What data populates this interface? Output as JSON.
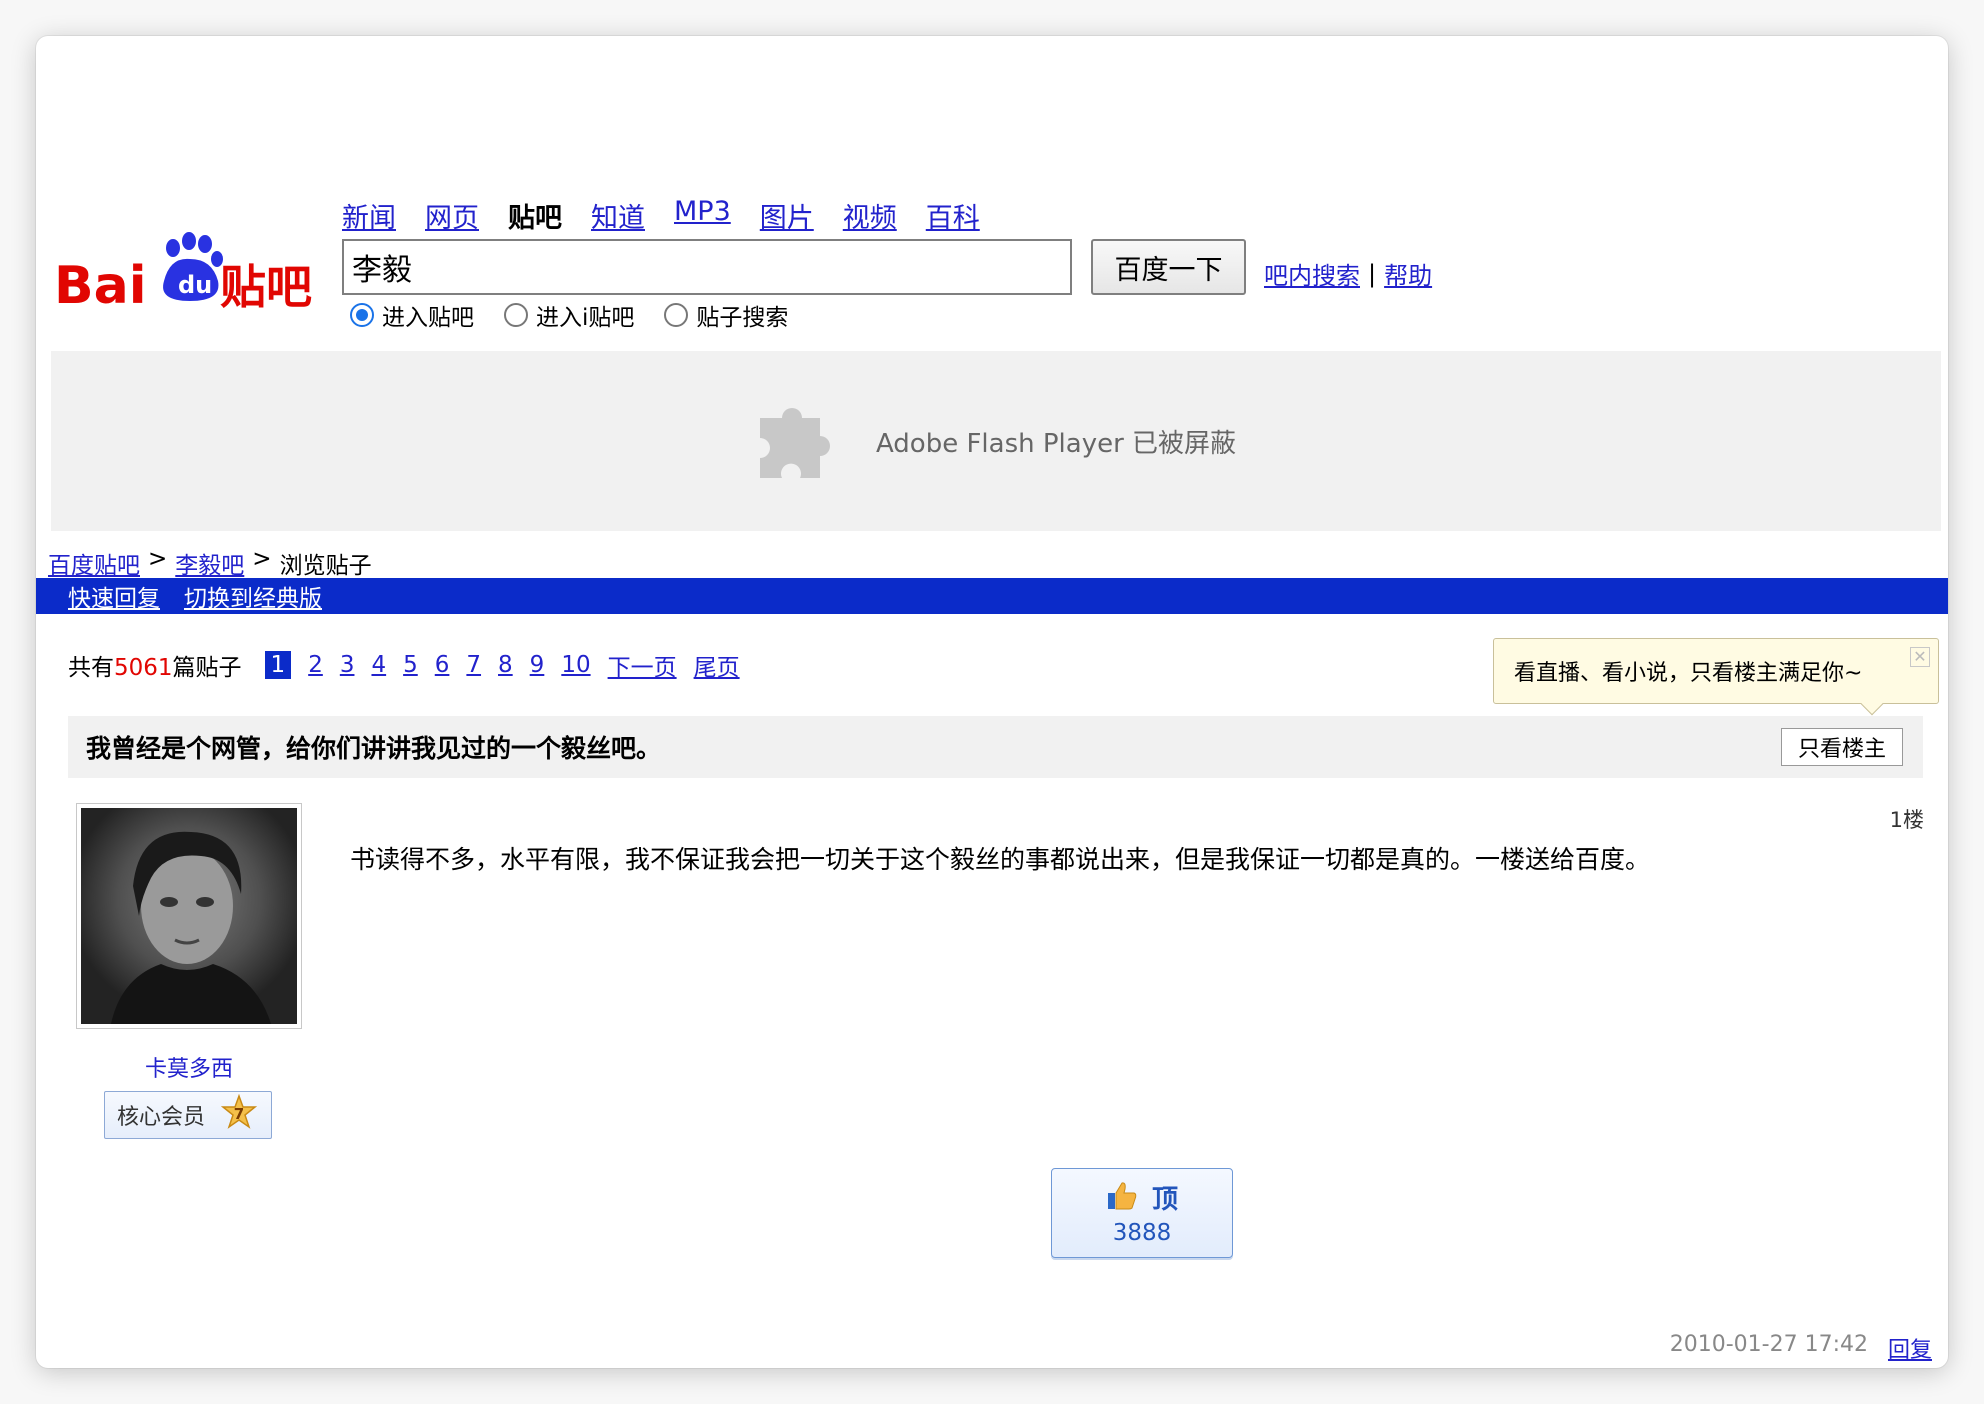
{
  "logo": {
    "text": "Baidu贴吧",
    "brand_red": "#e10602",
    "brand_blue": "#2932e1"
  },
  "nav": {
    "items": [
      "新闻",
      "网页",
      "贴吧",
      "知道",
      "MP3",
      "图片",
      "视频",
      "百科"
    ],
    "current": "贴吧"
  },
  "search": {
    "value": "李毅",
    "button": "百度一下",
    "in_bar_search": "吧内搜索",
    "separator": "|",
    "help": "帮助",
    "radios": [
      {
        "label": "进入贴吧",
        "checked": true
      },
      {
        "label": "进入i贴吧",
        "checked": false
      },
      {
        "label": "贴子搜索",
        "checked": false
      }
    ]
  },
  "flash": {
    "message": "Adobe Flash Player 已被屏蔽",
    "icon": "puzzle-piece-icon"
  },
  "breadcrumb": {
    "home": "百度贴吧",
    "sep": ">",
    "bar": "李毅吧",
    "current": "浏览贴子"
  },
  "bluebar": {
    "quick_reply": "快速回复",
    "classic": "切换到经典版",
    "color": "#0b2bc9"
  },
  "pager": {
    "prefix": "共有",
    "count": "5061",
    "suffix": "篇贴子",
    "pages": [
      "1",
      "2",
      "3",
      "4",
      "5",
      "6",
      "7",
      "8",
      "9",
      "10"
    ],
    "current": "1",
    "next": "下一页",
    "last": "尾页"
  },
  "tooltip": {
    "text": "看直播、看小说，只看楼主满足你~",
    "close": "✕"
  },
  "thread": {
    "title": "我曾经是个网管，给你们讲讲我见过的一个毅丝吧。",
    "only_op": "只看楼主"
  },
  "post": {
    "author": "卡莫多西",
    "member_label": "核心会员",
    "level": "7",
    "floor": "1楼",
    "content": "书读得不多，水平有限，我不保证我会把一切关于这个毅丝的事都说出来，但是我保证一切都是真的。一楼送给百度。",
    "ding_label": "顶",
    "ding_count": "3888",
    "time": "2010-01-27 17:42",
    "reply": "回复"
  }
}
